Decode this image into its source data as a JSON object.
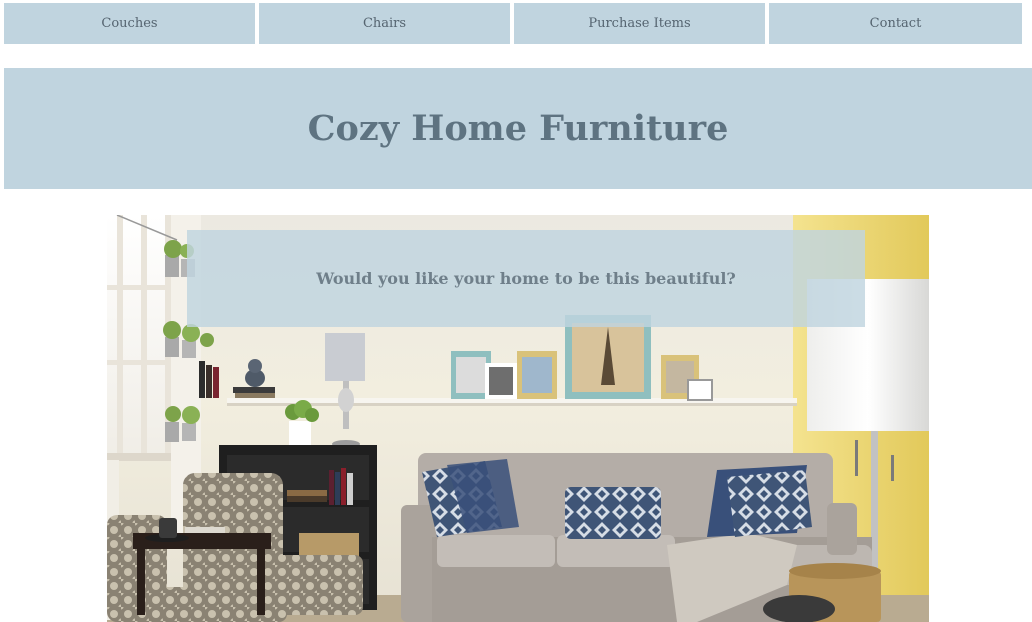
{
  "nav": {
    "items": [
      {
        "label": "Couches"
      },
      {
        "label": "Chairs"
      },
      {
        "label": "Purchase Items"
      },
      {
        "label": "Contact"
      }
    ]
  },
  "header": {
    "title": "Cozy Home Furniture"
  },
  "hero": {
    "banner_text": "Would you like your home to be this beautiful?"
  },
  "colors": {
    "nav_bg": "#c0d4df",
    "title_color": "#5e7381",
    "banner_bg": "#c0d4df"
  }
}
